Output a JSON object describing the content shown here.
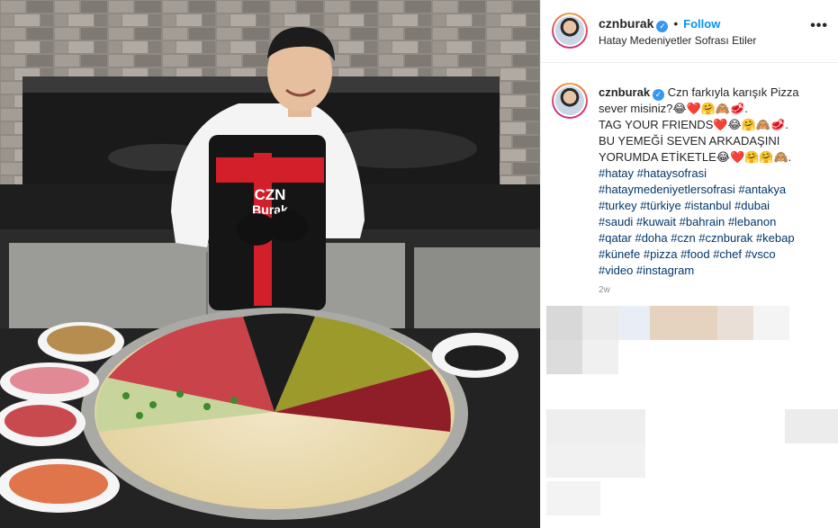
{
  "post": {
    "username": "cznburak",
    "verified_mark": "✓",
    "separator": "•",
    "follow_label": "Follow",
    "location": "Hatay Medeniyetler Sofrası Etiler",
    "more_icon": "•••",
    "caption_lines": [
      "Czn farkıyla karışık Pizza",
      "sever misiniz?😂❤️🤗🙈🥩.",
      "TAG YOUR FRIENDS❤️😂🤗🙈🥩.",
      "BU YEMEĞİ SEVEN ARKADAŞINI",
      "YORUMDA ETİKETLE😂❤️🤗🤗🙈."
    ],
    "hashtag_lines": [
      "#hatay #hataysofrasi",
      "#hataymedeniyetlersofrasi #antakya",
      "#turkey #türkiye #istanbul #dubai",
      "#saudi #kuwait #bahrain #lebanon",
      "#qatar #doha #czn #cznburak #kebap",
      "#künefe #pizza #food #chef #vsco",
      "#video #instagram"
    ],
    "time_ago": "2w"
  },
  "apron": {
    "text_line1": "CZN",
    "text_line2": "Burak"
  },
  "colors": {
    "accent_blue": "#0095f6",
    "hashtag_blue": "#00376b",
    "verified_blue": "#3897f0",
    "text": "#262626"
  }
}
